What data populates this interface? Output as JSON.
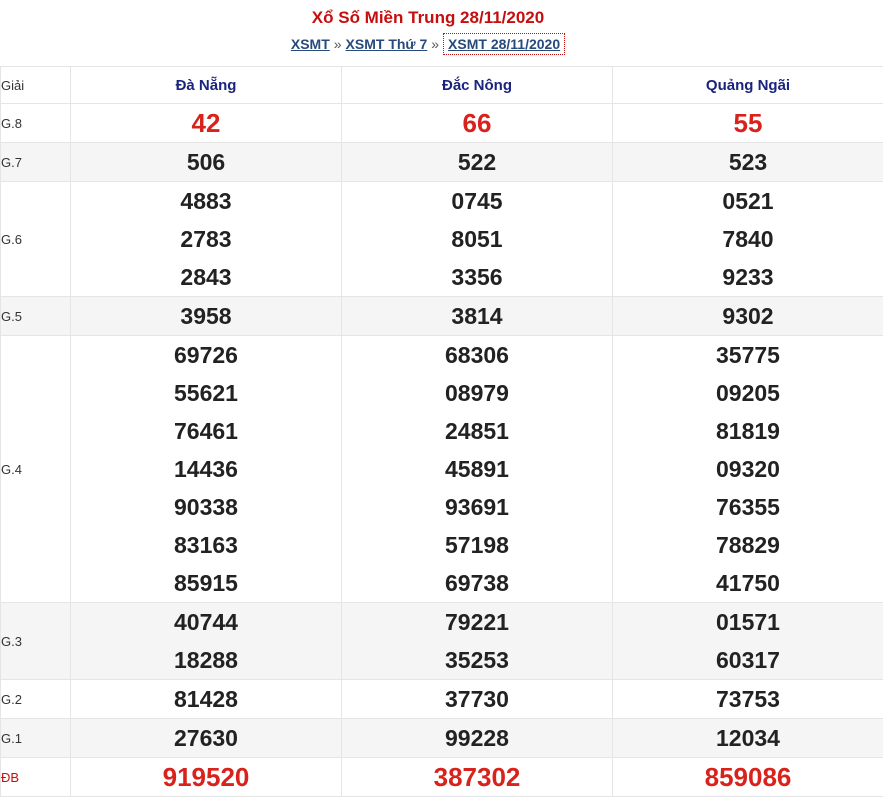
{
  "header": {
    "title": "Xổ Số Miền Trung 28/11/2020",
    "breadcrumb": [
      "XSMT",
      "XSMT Thứ 7",
      "XSMT 28/11/2020"
    ],
    "separator": "»"
  },
  "table": {
    "corner_label": "Giải",
    "provinces": [
      "Đà Nẵng",
      "Đắc Nông",
      "Quảng Ngãi"
    ],
    "prizes": [
      {
        "label": "G.8",
        "values": [
          [
            "42"
          ],
          [
            "66"
          ],
          [
            "55"
          ]
        ]
      },
      {
        "label": "G.7",
        "values": [
          [
            "506"
          ],
          [
            "522"
          ],
          [
            "523"
          ]
        ]
      },
      {
        "label": "G.6",
        "values": [
          [
            "4883",
            "2783",
            "2843"
          ],
          [
            "0745",
            "8051",
            "3356"
          ],
          [
            "0521",
            "7840",
            "9233"
          ]
        ]
      },
      {
        "label": "G.5",
        "values": [
          [
            "3958"
          ],
          [
            "3814"
          ],
          [
            "9302"
          ]
        ]
      },
      {
        "label": "G.4",
        "values": [
          [
            "69726",
            "55621",
            "76461",
            "14436",
            "90338",
            "83163",
            "85915"
          ],
          [
            "68306",
            "08979",
            "24851",
            "45891",
            "93691",
            "57198",
            "69738"
          ],
          [
            "35775",
            "09205",
            "81819",
            "09320",
            "76355",
            "78829",
            "41750"
          ]
        ]
      },
      {
        "label": "G.3",
        "values": [
          [
            "40744",
            "18288"
          ],
          [
            "79221",
            "35253"
          ],
          [
            "01571",
            "60317"
          ]
        ]
      },
      {
        "label": "G.2",
        "values": [
          [
            "81428"
          ],
          [
            "37730"
          ],
          [
            "73753"
          ]
        ]
      },
      {
        "label": "G.1",
        "values": [
          [
            "27630"
          ],
          [
            "99228"
          ],
          [
            "12034"
          ]
        ]
      },
      {
        "label": "ĐB",
        "values": [
          [
            "919520"
          ],
          [
            "387302"
          ],
          [
            "859086"
          ]
        ]
      }
    ]
  },
  "colors": {
    "title": "#c60e0e",
    "province": "#1a237e",
    "special": "#d8221b",
    "link": "#274a7c"
  }
}
